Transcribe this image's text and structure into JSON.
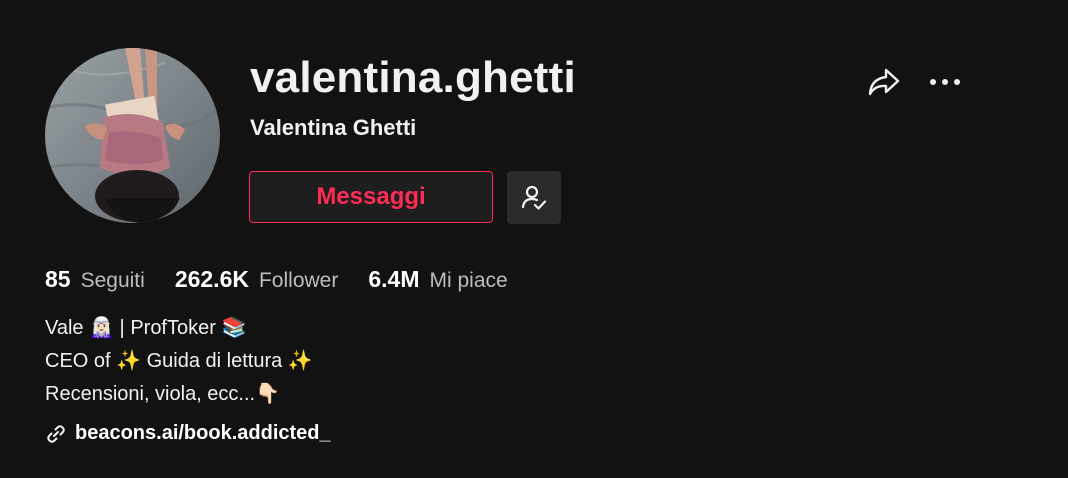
{
  "profile": {
    "username": "valentina.ghetti",
    "display_name": "Valentina Ghetti",
    "avatar_icon": "profile-photo"
  },
  "actions": {
    "message_label": "Messaggi",
    "follow_icon": "user-check-icon",
    "share_icon": "share-arrow-icon",
    "more_icon": "more-dots-icon"
  },
  "stats": [
    {
      "number": "85",
      "label": "Seguiti"
    },
    {
      "number": "262.6K",
      "label": "Follower"
    },
    {
      "number": "6.4M",
      "label": "Mi piace"
    }
  ],
  "bio": {
    "lines": [
      "Vale 🧝🏻‍♀️ | ProfToker 📚",
      "CEO of ✨ Guida di lettura ✨",
      "Recensioni, viola, ecc...👇🏻"
    ]
  },
  "link": {
    "text": "beacons.ai/book.addicted_",
    "icon": "link-icon"
  },
  "colors": {
    "background": "#121212",
    "accent": "#fe2c55",
    "secondary_button": "#2b2b2b"
  }
}
